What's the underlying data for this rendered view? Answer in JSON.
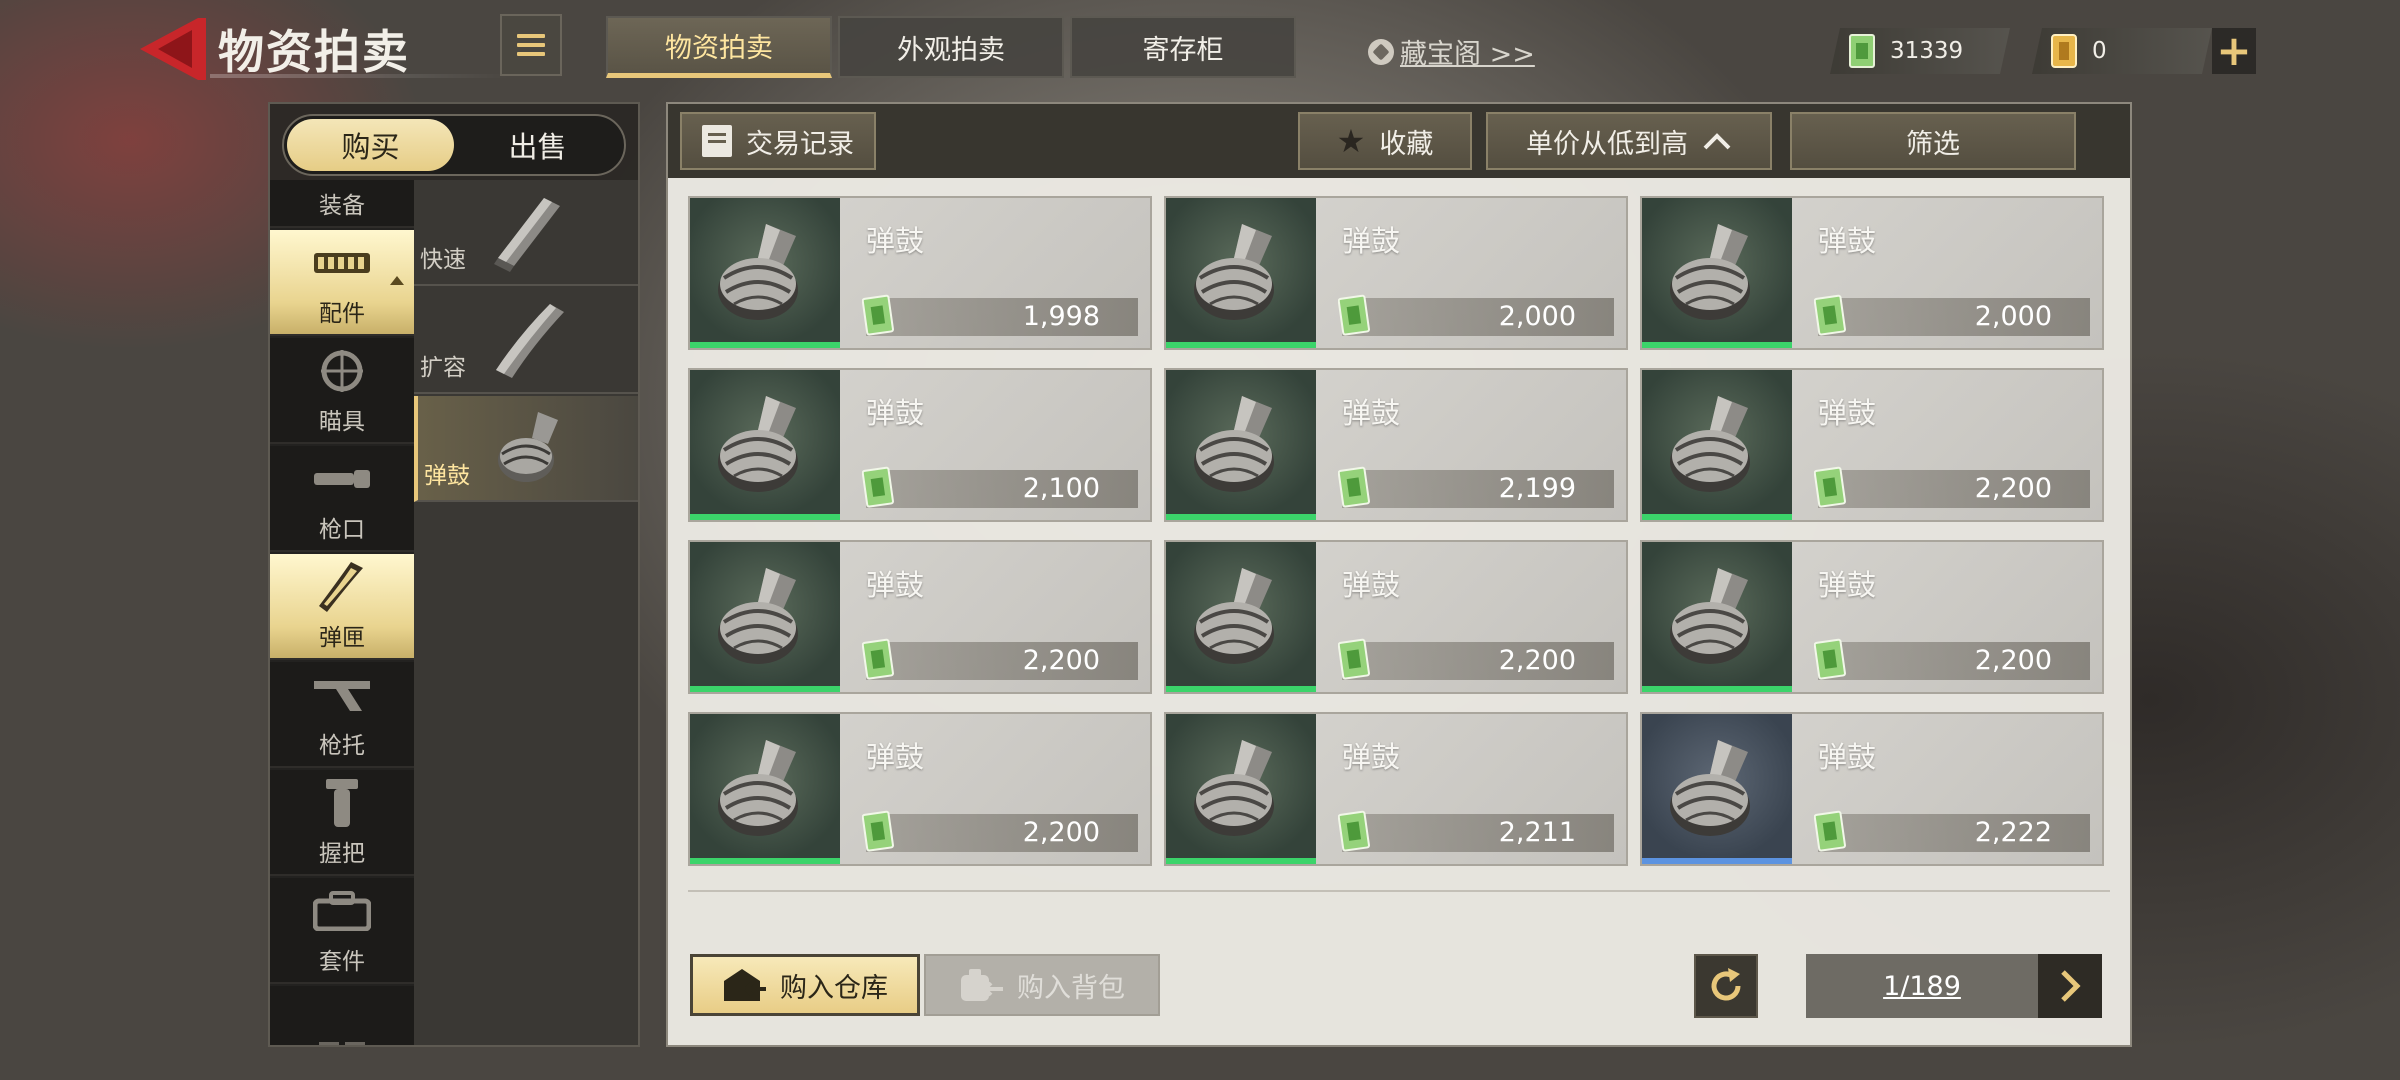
{
  "header": {
    "title": "物资拍卖",
    "tabs": [
      {
        "label": "物资拍卖",
        "active": true
      },
      {
        "label": "外观拍卖",
        "active": false
      },
      {
        "label": "寄存柜",
        "active": false
      }
    ],
    "treasure_link": "藏宝阁 >>",
    "currency_cash": "31339",
    "currency_ticket": "0",
    "accent_color": "#e8c77a"
  },
  "left_panel": {
    "buy_label": "购买",
    "sell_label": "出售",
    "categories": [
      {
        "label": "装备",
        "icon": "equipment-icon"
      },
      {
        "label": "配件",
        "icon": "attachment-icon",
        "active": true
      },
      {
        "label": "瞄具",
        "icon": "scope-icon"
      },
      {
        "label": "枪口",
        "icon": "muzzle-icon"
      },
      {
        "label": "弹匣",
        "icon": "magazine-icon",
        "active_style": true
      },
      {
        "label": "枪托",
        "icon": "stock-icon"
      },
      {
        "label": "握把",
        "icon": "grip-icon"
      },
      {
        "label": "套件",
        "icon": "kit-icon"
      }
    ],
    "subcategories": [
      {
        "label": "快速"
      },
      {
        "label": "扩容"
      },
      {
        "label": "弹鼓",
        "active": true
      }
    ]
  },
  "main": {
    "trade_record_label": "交易记录",
    "favorite_label": "收藏",
    "sort_label": "单价从低到高",
    "filter_label": "筛选",
    "items": [
      {
        "name": "弹鼓",
        "price": "1,998",
        "rarity": "green"
      },
      {
        "name": "弹鼓",
        "price": "2,000",
        "rarity": "green"
      },
      {
        "name": "弹鼓",
        "price": "2,000",
        "rarity": "green"
      },
      {
        "name": "弹鼓",
        "price": "2,100",
        "rarity": "green"
      },
      {
        "name": "弹鼓",
        "price": "2,199",
        "rarity": "green"
      },
      {
        "name": "弹鼓",
        "price": "2,200",
        "rarity": "green"
      },
      {
        "name": "弹鼓",
        "price": "2,200",
        "rarity": "green"
      },
      {
        "name": "弹鼓",
        "price": "2,200",
        "rarity": "green"
      },
      {
        "name": "弹鼓",
        "price": "2,200",
        "rarity": "green"
      },
      {
        "name": "弹鼓",
        "price": "2,200",
        "rarity": "green"
      },
      {
        "name": "弹鼓",
        "price": "2,211",
        "rarity": "green"
      },
      {
        "name": "弹鼓",
        "price": "2,222",
        "rarity": "blue"
      }
    ],
    "buy_warehouse_label": "购入仓库",
    "buy_backpack_label": "购入背包",
    "page": "1/189",
    "rarity_colors": {
      "green": "#3bd46a",
      "blue": "#5c93e0"
    }
  }
}
